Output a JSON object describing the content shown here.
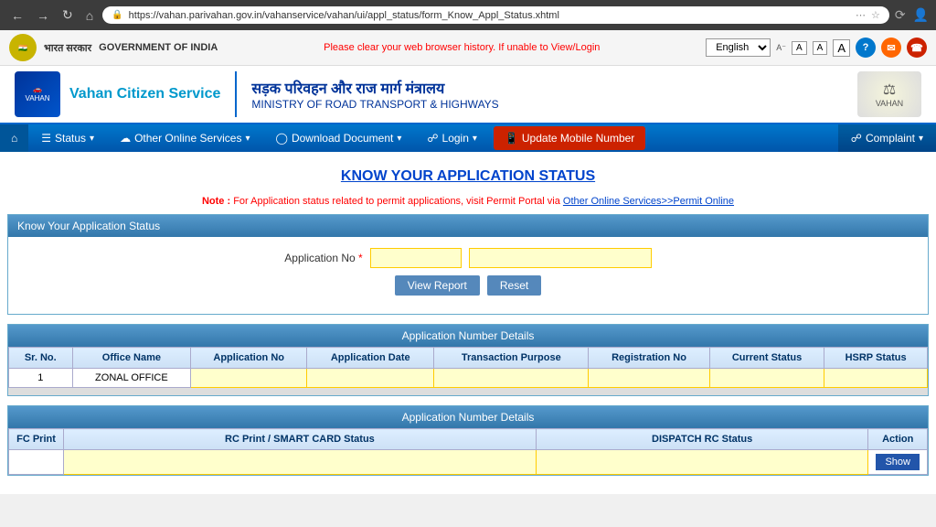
{
  "browser": {
    "nav_back": "←",
    "nav_forward": "→",
    "nav_refresh": "↺",
    "nav_home": "⌂",
    "url": "https://vahan.parivahan.gov.in/vahanservice/vahan/ui/appl_status/form_Know_Appl_Status.xhtml",
    "shield": "🛡",
    "lock": "🔒"
  },
  "gov_bar": {
    "logo_text": "भारत सरकार",
    "title": "GOVERNMENT OF INDIA",
    "alert": "Please clear your web browser history. If unable to View/Login",
    "lang": "English",
    "font_a_small": "A",
    "font_a_normal": "A",
    "font_a_large": "A"
  },
  "header": {
    "brand": "Vahan Citizen",
    "brand_sub": "Service",
    "hindi_title": "सड़क परिवहन और राज मार्ग मंत्रालय",
    "english_title": "MINISTRY OF ROAD TRANSPORT & HIGHWAYS",
    "emblem_text": "VAHAN"
  },
  "nav": {
    "home_icon": "⌂",
    "status": "Status",
    "other_services": "Other Online Services",
    "download": "Download Document",
    "login": "Login",
    "update_mobile": "Update Mobile Number",
    "complaint": "Complaint"
  },
  "page": {
    "title": "KNOW YOUR APPLICATION STATUS",
    "note_label": "Note :",
    "note_text": "For Application status related to permit applications, visit Permit Portal via Other Online Services>>Permit Online"
  },
  "form": {
    "section_title": "Know Your Application Status",
    "app_no_label": "Application No",
    "required": "*",
    "input1_placeholder": "",
    "input2_placeholder": "",
    "view_report_btn": "View Report",
    "reset_btn": "Reset"
  },
  "table1": {
    "section_title": "Application Number Details",
    "columns": [
      "Sr. No.",
      "Office Name",
      "Application No",
      "Application Date",
      "Transaction Purpose",
      "Registration No",
      "Current Status",
      "HSRP Status"
    ],
    "rows": [
      {
        "sr": "1",
        "office": "ZONAL OFFICE",
        "app_no": "",
        "app_date": "",
        "trans_purpose": "",
        "reg_no": "",
        "current_status": "",
        "hsrp_status": ""
      }
    ]
  },
  "table2": {
    "section_title": "Application Number Details",
    "columns": [
      "FC Print",
      "RC Print / SMART CARD Status",
      "DISPATCH RC Status",
      "Action"
    ],
    "rows": [
      {
        "fc_print": "",
        "rc_status": "",
        "dispatch_status": "",
        "action": "Show"
      }
    ]
  }
}
